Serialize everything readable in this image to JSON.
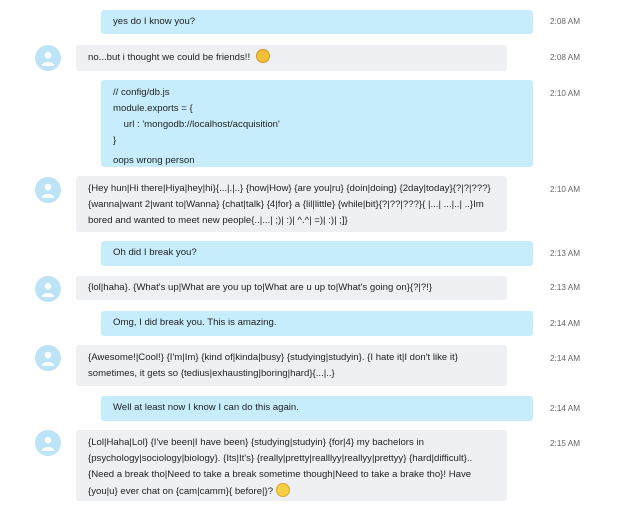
{
  "messages": [
    {
      "text": "yes do I know you?",
      "time": "2:08 AM"
    },
    {
      "text": "no...but i thought we could be friends!!",
      "time": "2:08 AM",
      "emoji": "grinning-emoji"
    },
    {
      "code": [
        "// config/db.js",
        "module.exports = {",
        "    url : 'mongodb://localhost/acquisition'",
        "}"
      ],
      "text": "oops wrong person",
      "time": "2:10 AM"
    },
    {
      "lines": [
        "{Hey hun|Hi there|Hiya|hey|hi}{...|.|..} {how|How} {are you|ru} {doin|doing} {2day|today}{?|?|???}",
        "{wanna|want 2|want to|Wanna} {chat|talk} {4|for} a {lil|little} {while|bit}{?|??|???}{ |...| ...|..| ..}Im",
        "bored and wanted to meet new people{..|...| ;)| :)| ^.^| =)| :)| ;]}"
      ],
      "time": "2:10 AM"
    },
    {
      "text": "Oh did I break you?",
      "time": "2:13 AM"
    },
    {
      "text": "{lol|haha}. {What's up|What are you up to|What are u up to|What's going on}{?|?!}",
      "time": "2:13 AM"
    },
    {
      "text": "Omg, I did break you. This is amazing.",
      "time": "2:14 AM"
    },
    {
      "lines": [
        "{Awesome!|Cool!} {I'm|Im} {kind of|kinda|busy} {studying|studyin}. {I hate it|I don't like it}",
        "sometimes, it gets so {tedius|exhausting|boring|hard}{...|..}"
      ],
      "time": "2:14 AM"
    },
    {
      "text": "Well at least now I know I can do this again.",
      "time": "2:14 AM"
    },
    {
      "lines": [
        "{Lol|Haha|Lol} {I've been|I have been} {studying|studyin} {for|4} my bachelors in",
        "{psychology|sociology|biology}. {Its|It's} {really|pretty|realllyy|reallyy|prettyy} {hard|difficult}..",
        "{Need a break tho|Need to take a break sometime though|Need to take a brake tho}! Have",
        "{you|u} ever chat on {cam|camm}{ before|}?"
      ],
      "time": "2:15 AM",
      "emoji": "smiling-emoji"
    }
  ]
}
